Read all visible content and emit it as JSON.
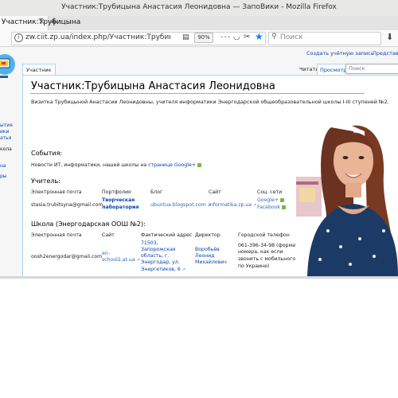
{
  "browser": {
    "window_title": "Участник:Трубицына Анастасия Леонидовна — ЗапоВики - Mozilla Firefox",
    "tab_label": "Участник:Трубицына",
    "url": "zw.ciit.zp.ua/index.php/Участник:Трубицына_Анас",
    "zoom": "90%",
    "search_placeholder": "Поиск"
  },
  "wiki": {
    "personal": [
      "Создать учётную запись",
      "Представиться"
    ],
    "left_tab": "Участник",
    "right_tabs": [
      "Читать",
      "Просмотр"
    ],
    "search_placeholder": "Поиск",
    "sidebar_fragments": [
      "ытия",
      "ики",
      "атья",
      "кола",
      "на",
      "ры"
    ]
  },
  "page": {
    "title": "Участник:Трубицына Анастасия Леонидовна",
    "intro": "Визитка Трубицыной Анастасии Леонидовны, учителя информатики Энергодарской общеобразовательной школы I-III ступеней №2.",
    "events": {
      "heading": "События:",
      "text": "Новости ИТ, информатики, нашей школы на",
      "link": "странице Google+"
    },
    "teacher": {
      "heading": "Учитель:",
      "columns": [
        "Электронная почта",
        "Портфолио",
        "Блог",
        "Сайт",
        "Соц. сети"
      ],
      "email": "stasia.trubitsyna@gmail.com",
      "portfolio_line1": "Творческая",
      "portfolio_line2": "лаборатория",
      "blog": "ubuntua.blogspot.com",
      "site": "informatika.zp.ua",
      "social1": "Google+",
      "social2": "Facebook"
    },
    "school": {
      "heading": "Школа (Энергодарская ООШ №2):",
      "columns": [
        "Электронная почта",
        "Сайт",
        "Фактический адрес",
        "Директор",
        "Городской телефон"
      ],
      "email": "oosh2energodar@gmail.com",
      "site_line1": "en-",
      "site_line2": "school2.at.ua",
      "address_lines": [
        "71503,",
        "Запорожская",
        "область, г.",
        "Энергодар, ул.",
        "Энергетиков, 6"
      ],
      "director_lines": [
        "Воробьёв",
        "Леонид",
        "Михайлович"
      ],
      "phone_lines": [
        "061-396-34-98 (формат",
        "номера, как если",
        "звонить с мобильного",
        "по Украине)"
      ]
    }
  },
  "colors": {
    "link": "#0645ad",
    "accent": "#0a84ff",
    "tab_border": "#a7d7f9"
  }
}
